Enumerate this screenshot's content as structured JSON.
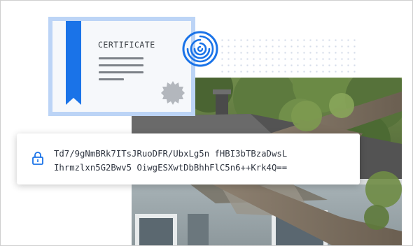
{
  "certificate": {
    "title": "CERTIFICATE"
  },
  "encrypted_card": {
    "line1": "Td7/9gNmBRk7ITsJRuoDFR/UbxLg5n fHBI3bTBzaDwsL",
    "line2": "Ihrmzlxn5G2Bwv5 OiwgESXwtDbBhhFlC5n6++Krk4Q=="
  },
  "colors": {
    "ribbon_blue": "#1a73e8",
    "card_border_blue": "#bcd4f6",
    "fingerprint_blue": "#1a73e8",
    "text_dark": "#2f3540"
  },
  "icons": [
    "fingerprint-icon",
    "lock-icon",
    "seal-icon",
    "ribbon-icon"
  ]
}
